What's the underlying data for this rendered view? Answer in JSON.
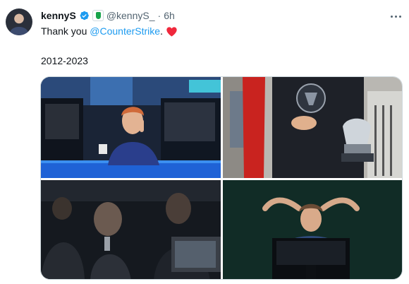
{
  "tweet": {
    "author": {
      "display_name": "kennyS",
      "handle": "@kennyS_",
      "avatar_icon": "player-avatar",
      "verified_icon": "verified-badge-icon",
      "affiliate_icon": "affiliate-badge-icon"
    },
    "separator": "·",
    "timestamp": "6h",
    "text": {
      "prefix": "Thank you ",
      "mention": "@CounterStrike",
      "suffix": ".",
      "emoji": "red-heart-icon",
      "line2": "2012-2023"
    },
    "media": [
      {
        "icon": "photo-player-at-desk"
      },
      {
        "icon": "photo-trophy-holder"
      },
      {
        "icon": "photo-players-dark-stage"
      },
      {
        "icon": "photo-player-celebrating"
      }
    ],
    "colors": {
      "text": "#0f1419",
      "secondary": "#536471",
      "link": "#1d9bf0",
      "heart": "#f91880"
    }
  }
}
